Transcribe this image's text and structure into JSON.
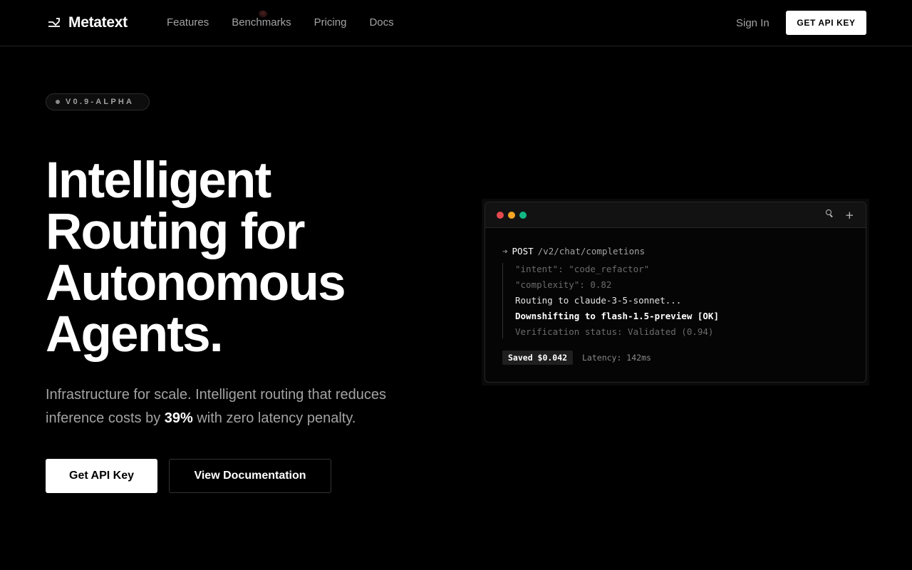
{
  "nav": {
    "brand": "Metatext",
    "links": [
      "Features",
      "Benchmarks",
      "Pricing",
      "Docs"
    ],
    "sign_in": "Sign In",
    "cta": "GET API KEY"
  },
  "hero": {
    "version_badge": "V0.9-ALPHA",
    "headline": [
      "Intelligent",
      "Routing for",
      "Autonomous",
      "Agents."
    ],
    "subtext_before": "Infrastructure for scale. Intelligent routing that reduces inference costs by ",
    "subtext_stat": "39%",
    "subtext_after": " with zero latency penalty.",
    "primary_button": "Get API Key",
    "secondary_button": "View Documentation"
  },
  "terminal": {
    "window_dots": [
      "#e5484d",
      "#f5a524",
      "#12b886"
    ],
    "icons": [
      "search-icon",
      "plus-icon"
    ],
    "request_arrow": "➜",
    "method": "POST",
    "path": "/v2/chat/completions",
    "log_lines": [
      "\"intent\": \"code_refactor\"",
      "\"complexity\": 0.82",
      "Routing to claude-3-5-sonnet...",
      "Downshifting to flash-1.5-preview [OK]",
      "Verification status: Validated (0.94)"
    ],
    "saved": "Saved $0.042",
    "latency": "Latency: 142ms"
  },
  "colors": {
    "background": "#000000",
    "text_primary": "#ffffff",
    "text_muted": "#a3a3a3",
    "border": "#262626"
  }
}
